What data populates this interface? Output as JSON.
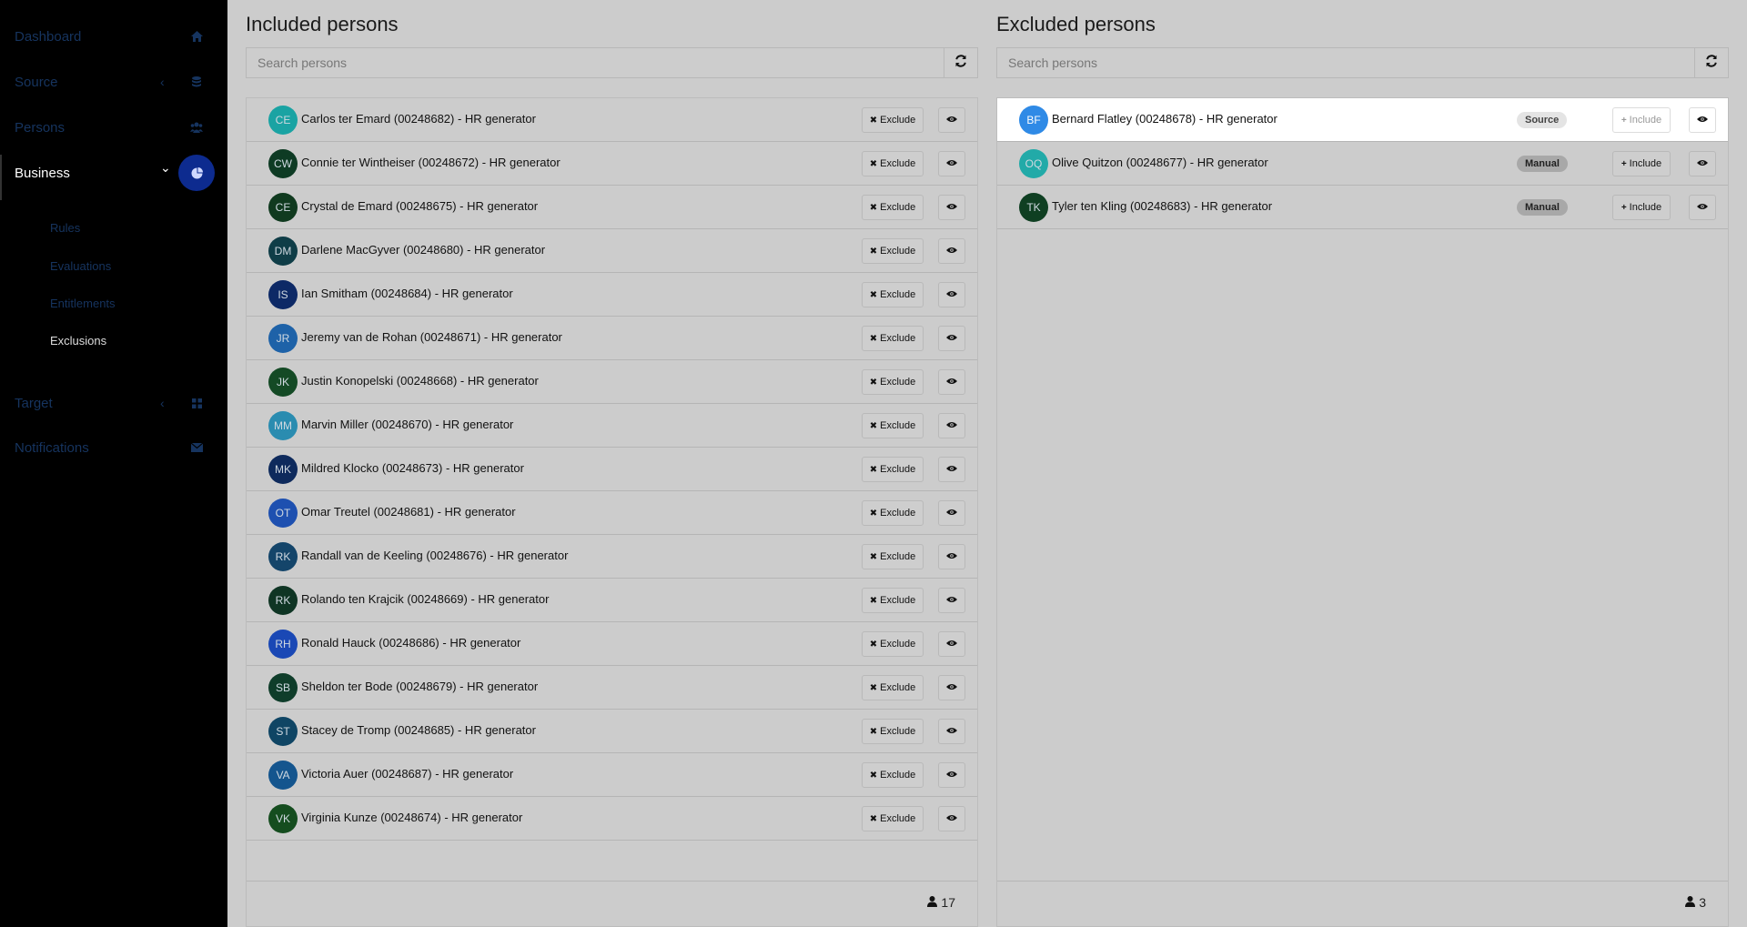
{
  "sidebar": {
    "items": [
      {
        "label": "Dashboard",
        "icon": "home-icon",
        "chevron": ""
      },
      {
        "label": "Source",
        "icon": "database-icon",
        "chevron": "‹"
      },
      {
        "label": "Persons",
        "icon": "users-icon",
        "chevron": ""
      },
      {
        "label": "Business",
        "icon": "pie-chart-icon",
        "chevron": "⌄"
      },
      {
        "label": "Target",
        "icon": "grid-icon",
        "chevron": "‹"
      },
      {
        "label": "Notifications",
        "icon": "envelope-icon",
        "chevron": ""
      }
    ],
    "sub_items": [
      "Rules",
      "Evaluations",
      "Entitlements",
      "Exclusions"
    ]
  },
  "included": {
    "title": "Included persons",
    "search_placeholder": "Search persons",
    "button_label": "Exclude",
    "count": "17",
    "rows": [
      {
        "initials": "CE",
        "name": "Carlos ter Emard (00248682) - HR generator",
        "color": "#1aa3a3"
      },
      {
        "initials": "CW",
        "name": "Connie ter Wintheiser (00248672) - HR generator",
        "color": "#0e3b24"
      },
      {
        "initials": "CE",
        "name": "Crystal de Emard (00248675) - HR generator",
        "color": "#103a1f"
      },
      {
        "initials": "DM",
        "name": "Darlene MacGyver (00248680) - HR generator",
        "color": "#0f3d47"
      },
      {
        "initials": "IS",
        "name": "Ian Smitham (00248684) - HR generator",
        "color": "#0d2966"
      },
      {
        "initials": "JR",
        "name": "Jeremy van de Rohan (00248671) - HR generator",
        "color": "#1e62a8"
      },
      {
        "initials": "JK",
        "name": "Justin Konopelski (00248668) - HR generator",
        "color": "#144a25"
      },
      {
        "initials": "MM",
        "name": "Marvin Miller (00248670) - HR generator",
        "color": "#2a8cb0"
      },
      {
        "initials": "MK",
        "name": "Mildred Klocko (00248673) - HR generator",
        "color": "#0e2a5c"
      },
      {
        "initials": "OT",
        "name": "Omar Treutel (00248681) - HR generator",
        "color": "#1e50b0"
      },
      {
        "initials": "RK",
        "name": "Randall van de Keeling (00248676) - HR generator",
        "color": "#14456a"
      },
      {
        "initials": "RK",
        "name": "Rolando ten Krajcik (00248669) - HR generator",
        "color": "#0f3524"
      },
      {
        "initials": "RH",
        "name": "Ronald Hauck (00248686) - HR generator",
        "color": "#1a48b5"
      },
      {
        "initials": "SB",
        "name": "Sheldon ter Bode (00248679) - HR generator",
        "color": "#0f3d2a"
      },
      {
        "initials": "ST",
        "name": "Stacey de Tromp (00248685) - HR generator",
        "color": "#0f4564"
      },
      {
        "initials": "VA",
        "name": "Victoria Auer (00248687) - HR generator",
        "color": "#14558e"
      },
      {
        "initials": "VK",
        "name": "Virginia Kunze (00248674) - HR generator",
        "color": "#154d1f"
      }
    ]
  },
  "excluded": {
    "title": "Excluded persons",
    "search_placeholder": "Search persons",
    "button_label": "Include",
    "count": "3",
    "rows": [
      {
        "initials": "BF",
        "name": "Bernard Flatley (00248678) - HR generator",
        "badge": "Source",
        "color": "#2f8ae6"
      },
      {
        "initials": "OQ",
        "name": "Olive Quitzon (00248677) - HR generator",
        "badge": "Manual",
        "color": "#22aaa8"
      },
      {
        "initials": "TK",
        "name": "Tyler ten Kling (00248683) - HR generator",
        "badge": "Manual",
        "color": "#0f3f22"
      }
    ]
  }
}
